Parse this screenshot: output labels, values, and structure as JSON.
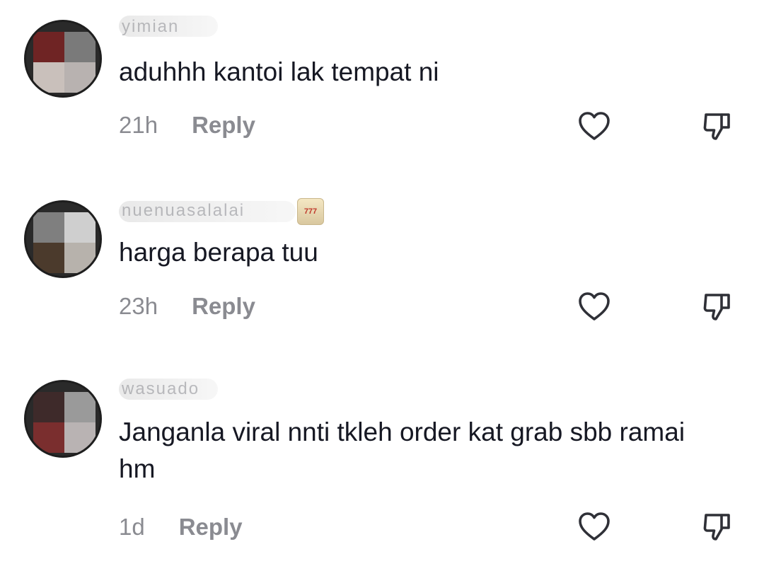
{
  "comments": [
    {
      "username": "yimian",
      "text": "aduhhh kantoi lak tempat ni",
      "time": "21h",
      "reply_label": "Reply",
      "avatar_colors": [
        "#6f2424",
        "#7a7a7a",
        "#c9c0bb",
        "#b8b2b0"
      ]
    },
    {
      "username": "nuenuasalalai",
      "text": "harga berapa tuu",
      "time": "23h",
      "reply_label": "Reply",
      "avatar_colors": [
        "#7f7f7f",
        "#cfcfcf",
        "#4b3a2c",
        "#b7b2ac"
      ],
      "badge": "777"
    },
    {
      "username": "wasuado",
      "text": "Janganla viral nnti tkleh order kat grab sbb ramai hm",
      "time": "1d",
      "reply_label": "Reply",
      "avatar_colors": [
        "#3e2a2a",
        "#9a9a9a",
        "#7a2e2e",
        "#b9b3b3"
      ]
    }
  ],
  "icons": {
    "like": "heart-outline-icon",
    "dislike": "thumbs-down-outline-icon"
  },
  "colors": {
    "primary_text": "#161823",
    "secondary_text": "#8a8b91",
    "icon_stroke": "#2f3037"
  }
}
